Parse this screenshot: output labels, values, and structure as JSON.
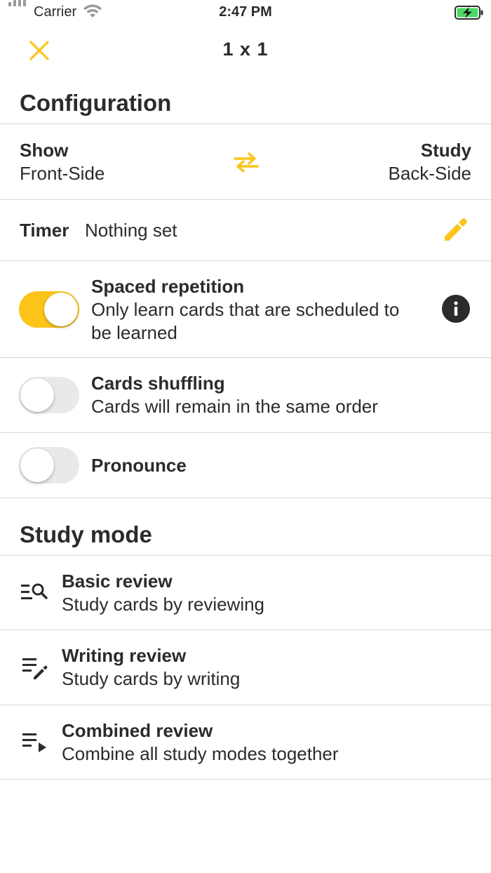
{
  "status_bar": {
    "carrier": "Carrier",
    "time": "2:47 PM"
  },
  "nav": {
    "title": "1 x 1"
  },
  "configuration": {
    "heading": "Configuration",
    "show_label": "Show",
    "show_value": "Front-Side",
    "study_label": "Study",
    "study_value": "Back-Side",
    "timer_label": "Timer",
    "timer_value": "Nothing set"
  },
  "options": {
    "spaced_repetition": {
      "title": "Spaced repetition",
      "desc_line1": "Only learn cards that are scheduled to",
      "desc_line2": "be learned",
      "on": true
    },
    "cards_shuffling": {
      "title": "Cards shuffling",
      "desc": "Cards will remain in the same order",
      "on": false
    },
    "pronounce": {
      "title": "Pronounce",
      "on": false
    }
  },
  "study_mode": {
    "heading": "Study mode",
    "items": [
      {
        "title": "Basic review",
        "desc": "Study cards by reviewing",
        "icon": "list-search-icon"
      },
      {
        "title": "Writing review",
        "desc": "Study cards by writing",
        "icon": "list-edit-icon"
      },
      {
        "title": "Combined review",
        "desc": "Combine all study modes together",
        "icon": "list-play-icon"
      }
    ]
  },
  "colors": {
    "accent": "#fcc419",
    "text": "#2b2b2b",
    "divider": "#d7d7d7",
    "toggle_off": "#e9e9ea",
    "battery": "#4cd964"
  },
  "icons": {
    "close": "close-icon",
    "swap": "swap-arrows-icon",
    "edit": "pencil-icon",
    "info": "info-icon"
  }
}
